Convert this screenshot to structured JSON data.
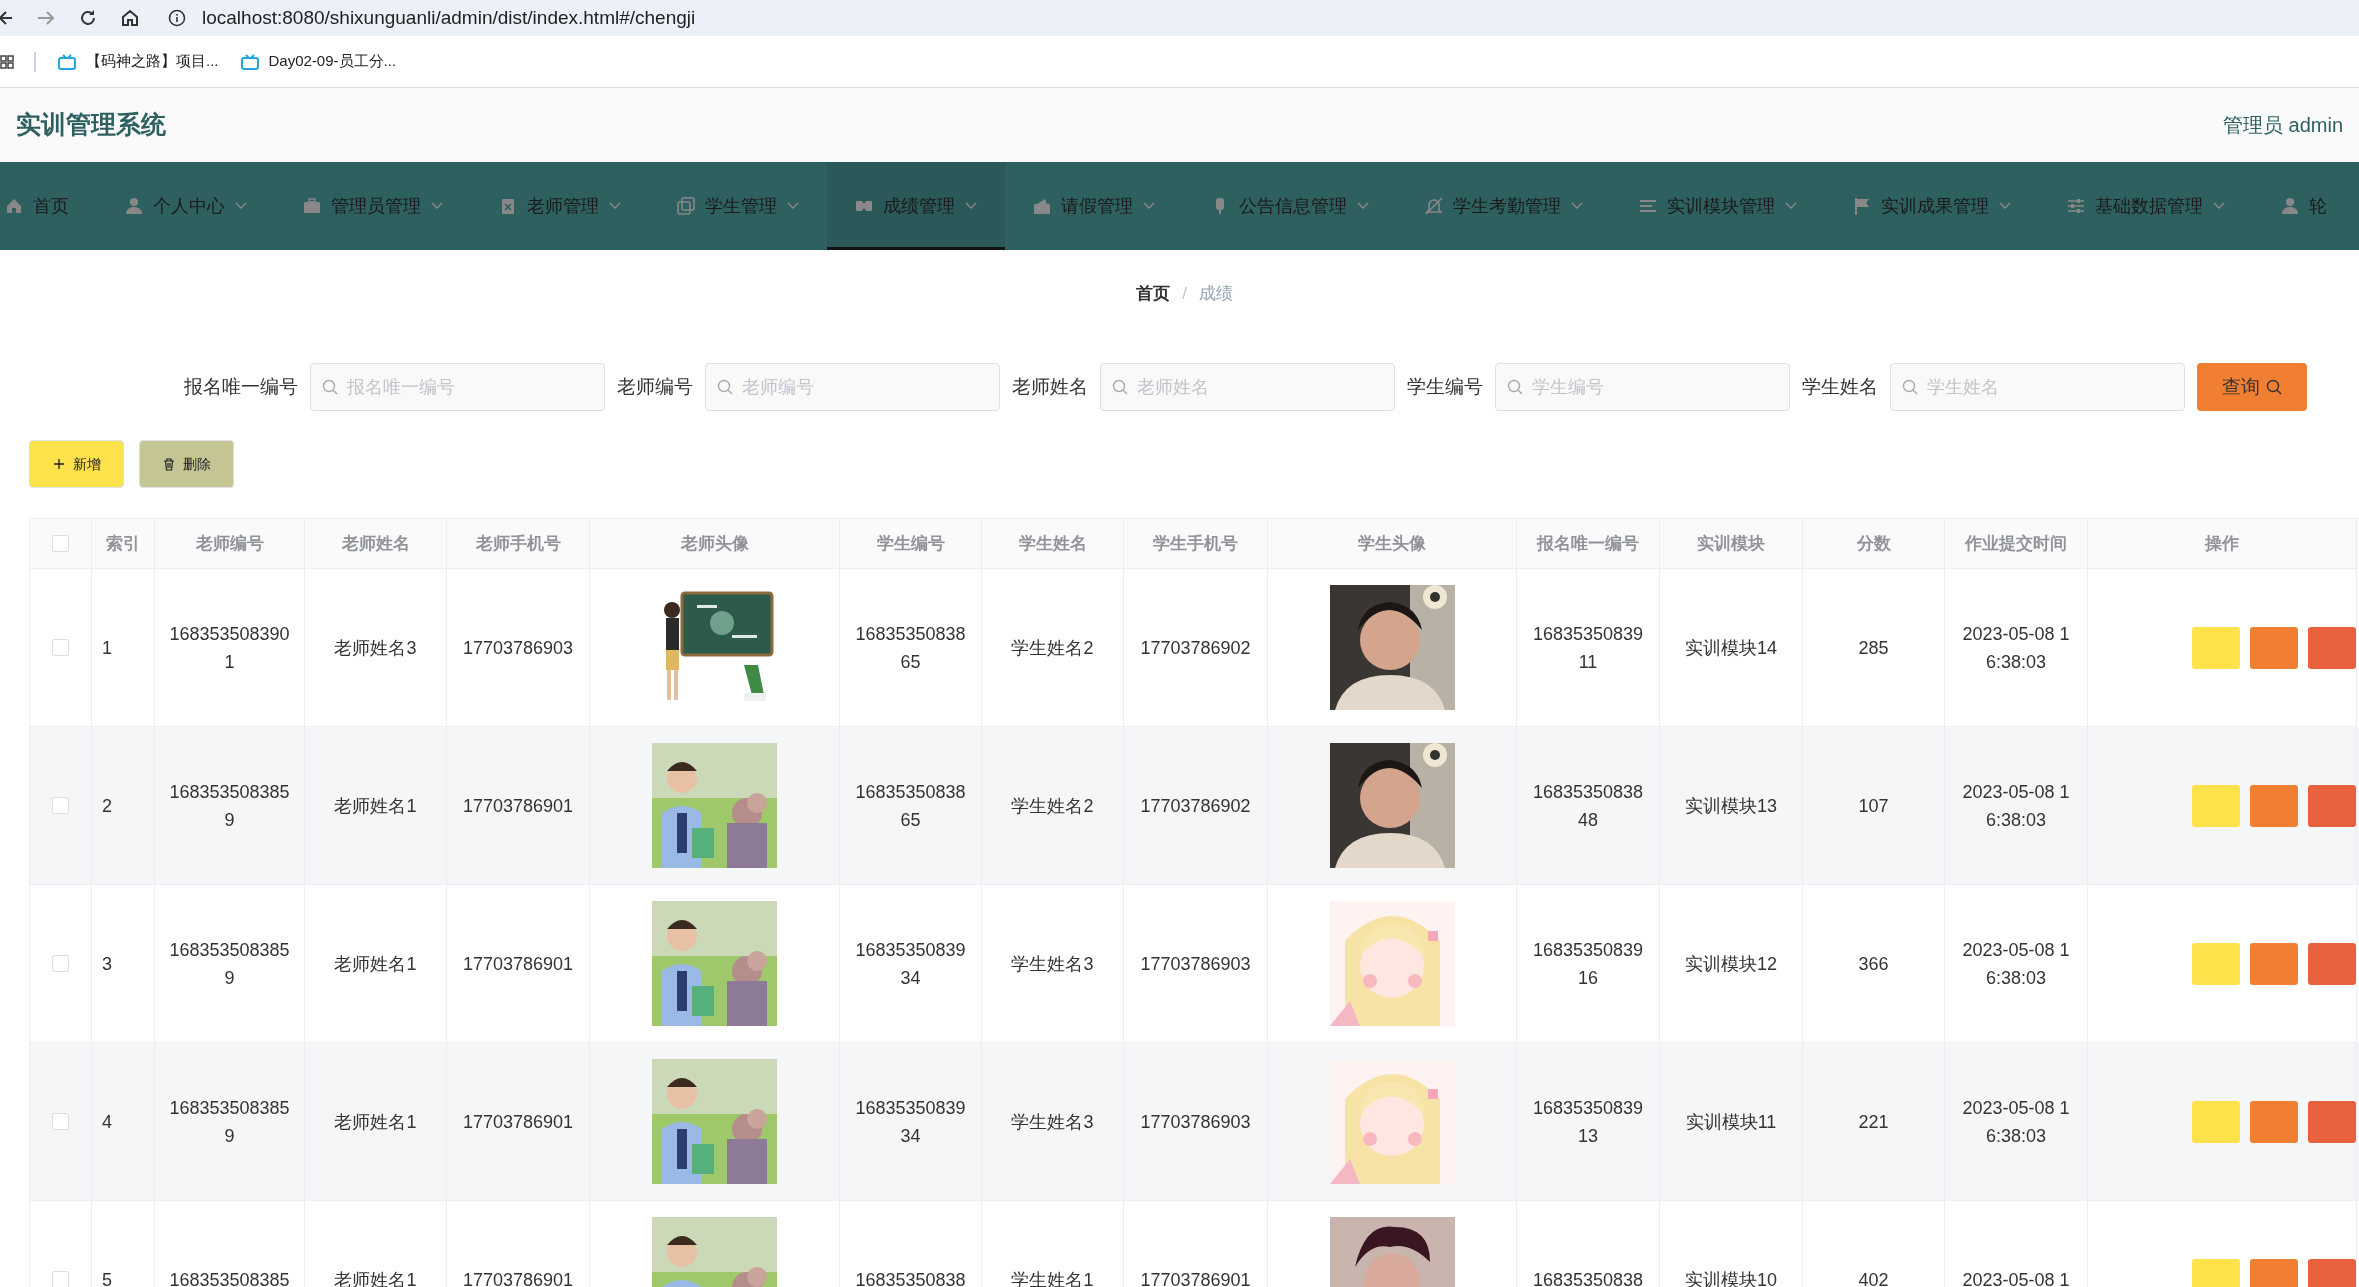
{
  "browser": {
    "url": "localhost:8080/shixunguanli/admin/dist/index.html#/chengji",
    "bookmarks": [
      "【码神之路】项目...",
      "Day02-09-员工分..."
    ]
  },
  "header": {
    "title": "实训管理系统",
    "user": "管理员 admin"
  },
  "nav": [
    {
      "label": "首页",
      "selected": false,
      "dropdown": false
    },
    {
      "label": "个人中心",
      "selected": false,
      "dropdown": true
    },
    {
      "label": "管理员管理",
      "selected": false,
      "dropdown": true
    },
    {
      "label": "老师管理",
      "selected": false,
      "dropdown": true
    },
    {
      "label": "学生管理",
      "selected": false,
      "dropdown": true
    },
    {
      "label": "成绩管理",
      "selected": true,
      "dropdown": true
    },
    {
      "label": "请假管理",
      "selected": false,
      "dropdown": true
    },
    {
      "label": "公告信息管理",
      "selected": false,
      "dropdown": true
    },
    {
      "label": "学生考勤管理",
      "selected": false,
      "dropdown": true
    },
    {
      "label": "实训模块管理",
      "selected": false,
      "dropdown": true
    },
    {
      "label": "实训成果管理",
      "selected": false,
      "dropdown": true
    },
    {
      "label": "基础数据管理",
      "selected": false,
      "dropdown": true
    },
    {
      "label": "轮",
      "selected": false,
      "dropdown": false
    }
  ],
  "breadcrumb": {
    "items": [
      "首页",
      "成绩"
    ],
    "separator": "/"
  },
  "filters": [
    {
      "label": "报名唯一编号",
      "placeholder": "报名唯一编号"
    },
    {
      "label": "老师编号",
      "placeholder": "老师编号"
    },
    {
      "label": "老师姓名",
      "placeholder": "老师姓名"
    },
    {
      "label": "学生编号",
      "placeholder": "学生编号"
    },
    {
      "label": "学生姓名",
      "placeholder": "学生姓名"
    }
  ],
  "search_button": "查询",
  "actions": [
    "新增",
    "删除"
  ],
  "table": {
    "all_selected": false,
    "columns": [
      "索引",
      "老师编号",
      "老师姓名",
      "老师手机号",
      "老师头像",
      "学生编号",
      "学生姓名",
      "学生手机号",
      "学生头像",
      "报名唯一编号",
      "实训模块",
      "分数",
      "作业提交时间",
      "操作"
    ],
    "rows": [
      {
        "selected": false,
        "cells": [
          "1",
          "1683535083901",
          "老师姓名3",
          "17703786903",
          null,
          "1683535083865",
          "学生姓名2",
          "17703786902",
          null,
          "1683535083911",
          "实训模块14",
          "285",
          "2023-05-08 16:38:03"
        ]
      },
      {
        "selected": false,
        "cells": [
          "2",
          "1683535083859",
          "老师姓名1",
          "17703786901",
          null,
          "1683535083865",
          "学生姓名2",
          "17703786902",
          null,
          "1683535083848",
          "实训模块13",
          "107",
          "2023-05-08 16:38:03"
        ]
      },
      {
        "selected": false,
        "cells": [
          "3",
          "1683535083859",
          "老师姓名1",
          "17703786901",
          null,
          "1683535083934",
          "学生姓名3",
          "17703786903",
          null,
          "1683535083916",
          "实训模块12",
          "366",
          "2023-05-08 16:38:03"
        ]
      },
      {
        "selected": false,
        "cells": [
          "4",
          "1683535083859",
          "老师姓名1",
          "17703786901",
          null,
          "1683535083934",
          "学生姓名3",
          "17703786903",
          null,
          "1683535083913",
          "实训模块11",
          "221",
          "2023-05-08 16:38:03"
        ]
      },
      {
        "selected": false,
        "cells": [
          "5",
          "168353508385",
          "老师姓名1",
          "17703786901",
          null,
          "16835350838",
          "学生姓名1",
          "17703786901",
          null,
          "16835350838",
          "实训模块10",
          "402",
          "2023-05-08 1"
        ]
      }
    ]
  }
}
